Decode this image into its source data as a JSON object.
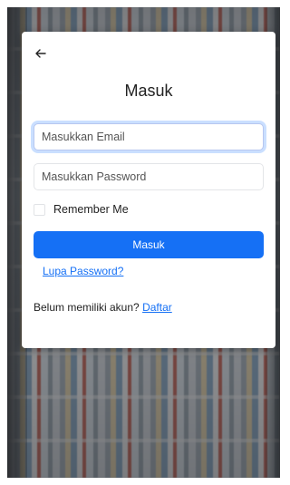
{
  "login": {
    "title": "Masuk",
    "back_icon": "arrow-left-icon",
    "email": {
      "placeholder": "Masukkan Email",
      "value": ""
    },
    "password": {
      "placeholder": "Masukkan Password",
      "value": ""
    },
    "remember_label": "Remember Me",
    "remember_checked": false,
    "submit_label": "Masuk",
    "forgot_label": "Lupa Password?",
    "register_prompt": "Belum memiliki akun?",
    "register_link": "Daftar"
  },
  "colors": {
    "primary": "#1570f5",
    "card": "#ffffff"
  }
}
